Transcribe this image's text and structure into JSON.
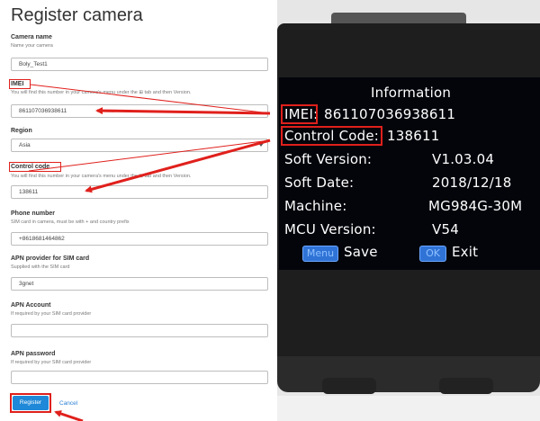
{
  "form": {
    "title": "Register camera",
    "camera_name": {
      "label": "Camera name",
      "hint": "Name your camera",
      "value": "Boly_Test1"
    },
    "imei": {
      "label": "IMEI",
      "hint": "You will find this number in your camera's menu under the ⊞ tab and then Version.",
      "value": "861107036938611"
    },
    "region": {
      "label": "Region",
      "value": "Asia"
    },
    "control_code": {
      "label": "Control code",
      "hint": "You will find this number in your camera's menu under the ⊞ tab and then Version.",
      "value": "138611"
    },
    "phone": {
      "label": "Phone number",
      "hint": "SIM card in camera, must be with + and country prefix",
      "value": "+8618681464862"
    },
    "apn_provider": {
      "label": "APN provider for SIM card",
      "hint": "Supplied with the SIM card",
      "value": "3gnet"
    },
    "apn_account": {
      "label": "APN Account",
      "hint": "If required by your SIM card provider",
      "value": ""
    },
    "apn_password": {
      "label": "APN password",
      "hint": "If required by your SIM card provider",
      "value": ""
    },
    "register_label": "Register",
    "cancel_label": "Cancel"
  },
  "camera_screen": {
    "heading": "Information",
    "imei_label": "IMEI:",
    "imei_value": "861107036938611",
    "control_label": "Control Code:",
    "control_value": "138611",
    "rows": [
      {
        "label": "Soft Version:",
        "value": "V1.03.04"
      },
      {
        "label": "Soft Date:",
        "value": "2018/12/18"
      },
      {
        "label": "Machine:",
        "value": "MG984G-30M"
      },
      {
        "label": "MCU Version:",
        "value": "V54"
      }
    ],
    "menu_chip": "Menu",
    "save_label": "Save",
    "ok_chip": "OK",
    "exit_label": "Exit"
  },
  "colors": {
    "annotation_red": "#e0201c",
    "register_blue": "#1f88d8",
    "screen_chip_blue": "#2f73d6"
  }
}
